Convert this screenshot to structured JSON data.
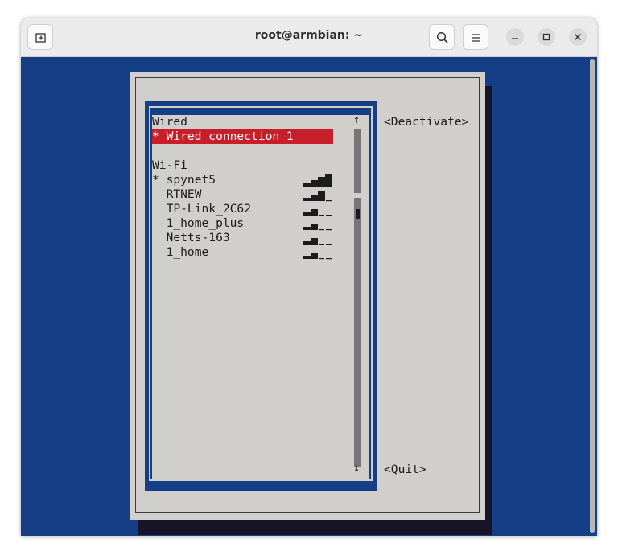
{
  "window": {
    "title": "root@armbian: ~",
    "icons": {
      "new_tab": "new-tab-icon",
      "search": "search-icon",
      "menu": "hamburger-menu-icon",
      "minimize": "minimize-icon",
      "maximize": "maximize-icon",
      "close": "close-icon"
    }
  },
  "nmtui": {
    "wired_header": "Wired",
    "wired_connection": "* Wired connection 1",
    "wifi_header": "Wi-Fi",
    "networks": [
      {
        "label": "* spynet5",
        "signal_bars": 4
      },
      {
        "label": "  RTNEW",
        "signal_bars": 3
      },
      {
        "label": "  TP-Link_2C62",
        "signal_bars": 2
      },
      {
        "label": "  1_home_plus",
        "signal_bars": 2
      },
      {
        "label": "  Netts-163",
        "signal_bars": 2
      },
      {
        "label": "  1_home",
        "signal_bars": 2
      }
    ],
    "scroll_up": "↑",
    "scroll_down": "↓",
    "deactivate_button": "<Deactivate>",
    "quit_button": "<Quit>"
  },
  "colors": {
    "terminal_bg": "#143f86",
    "dialog_bg": "#d0cfcc",
    "selection": "#c81e2a"
  }
}
